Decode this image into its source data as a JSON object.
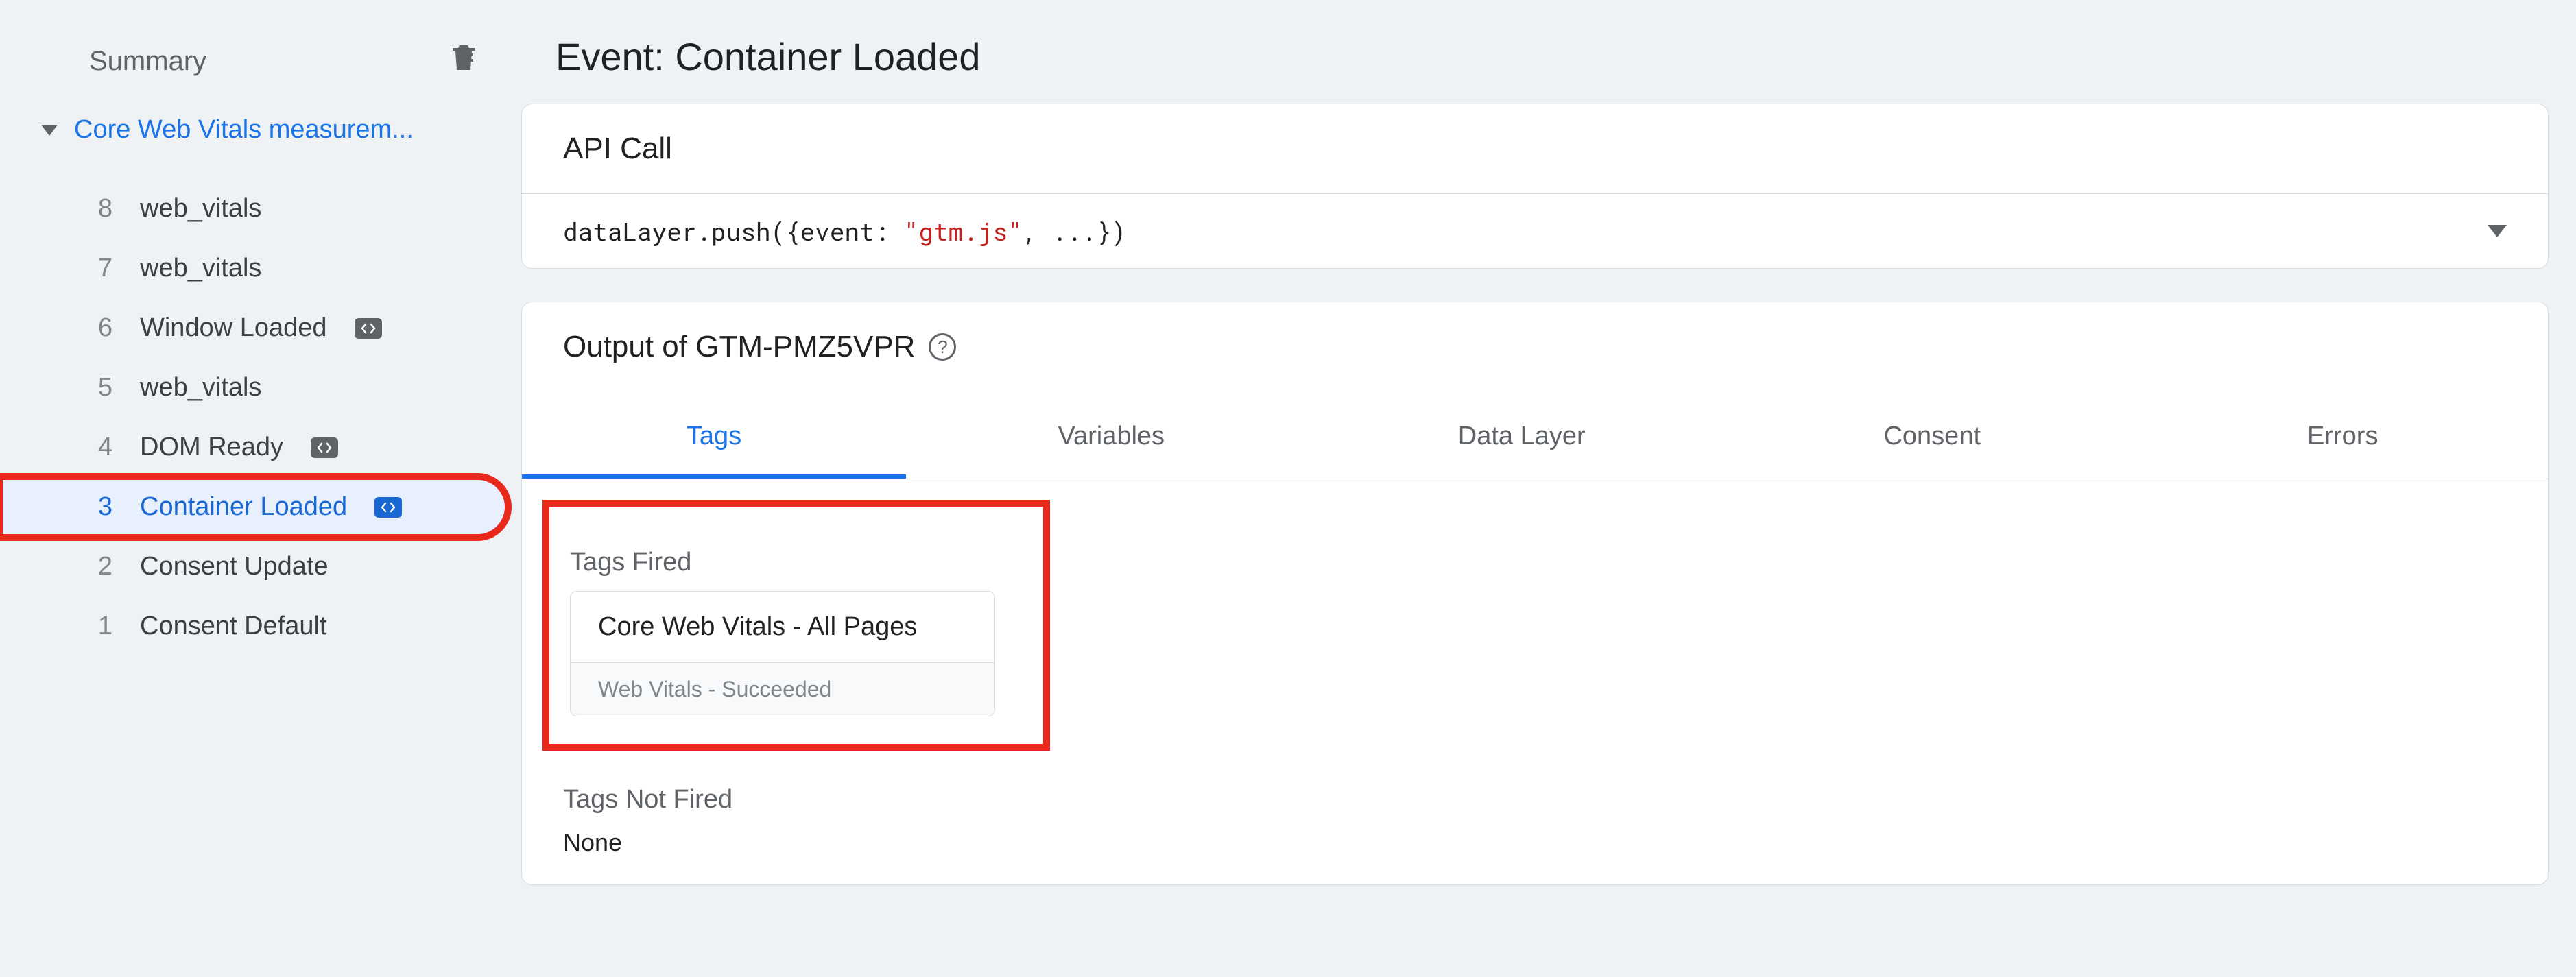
{
  "sidebar": {
    "summary_label": "Summary",
    "root_label": "Core Web Vitals measurem...",
    "items": [
      {
        "num": "8",
        "label": "web_vitals",
        "chip": false,
        "selected": false
      },
      {
        "num": "7",
        "label": "web_vitals",
        "chip": false,
        "selected": false
      },
      {
        "num": "6",
        "label": "Window Loaded",
        "chip": true,
        "selected": false
      },
      {
        "num": "5",
        "label": "web_vitals",
        "chip": false,
        "selected": false
      },
      {
        "num": "4",
        "label": "DOM Ready",
        "chip": true,
        "selected": false
      },
      {
        "num": "3",
        "label": "Container Loaded",
        "chip": true,
        "selected": true,
        "highlight": true
      },
      {
        "num": "2",
        "label": "Consent Update",
        "chip": false,
        "selected": false
      },
      {
        "num": "1",
        "label": "Consent Default",
        "chip": false,
        "selected": false
      }
    ]
  },
  "page": {
    "title": "Event: Container Loaded",
    "api_call_header": "API Call",
    "api_call": {
      "pre": "dataLayer.push({event: ",
      "str": "\"gtm.js\"",
      "post": ", ...})"
    },
    "output_header": "Output of GTM-PMZ5VPR",
    "tabs": [
      "Tags",
      "Variables",
      "Data Layer",
      "Consent",
      "Errors"
    ],
    "active_tab": "Tags",
    "tags_fired_label": "Tags Fired",
    "tag_card": {
      "title": "Core Web Vitals - All Pages",
      "status": "Web Vitals - Succeeded"
    },
    "tags_not_fired_label": "Tags Not Fired",
    "none_label": "None"
  }
}
